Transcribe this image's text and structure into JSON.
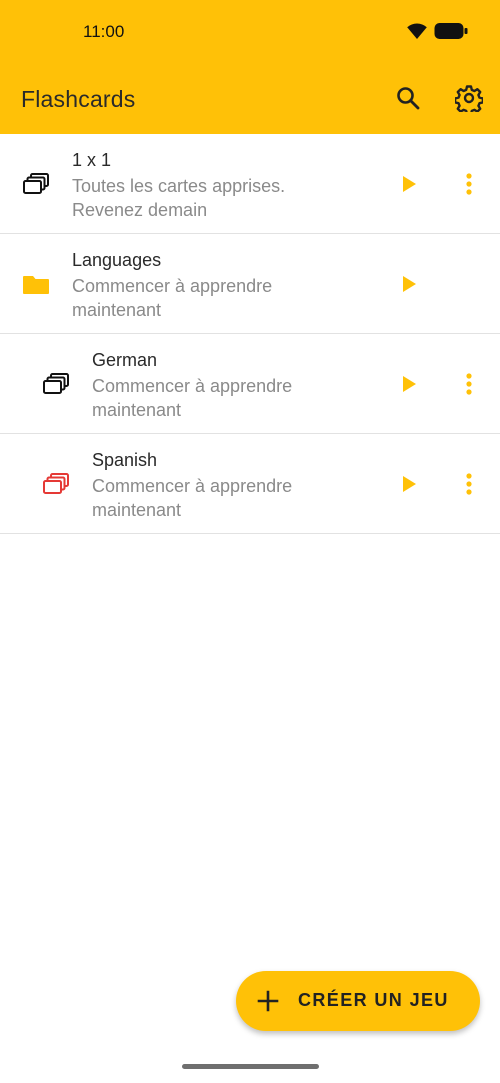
{
  "status_bar": {
    "time": "11:00",
    "wifi_icon": "wifi-icon",
    "battery_icon": "battery-icon"
  },
  "appbar": {
    "title": "Flashcards",
    "search_icon": "search-icon",
    "settings_icon": "gear-icon",
    "color": "#FFC107"
  },
  "decks": [
    {
      "name": "1 x 1",
      "line1": "Toutes les cartes apprises.",
      "line2": "Revenez demain",
      "icon": "cards-icon",
      "icon_color": "#111111",
      "has_menu": true
    },
    {
      "name": "Languages",
      "line1": "Commencer à apprendre",
      "line2": "maintenant",
      "icon": "folder-icon",
      "icon_color": "#FFC107",
      "has_menu": false
    },
    {
      "name": "German",
      "line1": "Commencer à apprendre",
      "line2": "maintenant",
      "icon": "cards-icon",
      "icon_color": "#111111",
      "has_menu": true
    },
    {
      "name": "Spanish",
      "line1": "Commencer à apprendre",
      "line2": "maintenant",
      "icon": "cards-icon",
      "icon_color": "#E53935",
      "has_menu": true
    }
  ],
  "fab": {
    "label": "CRÉER UN JEU",
    "icon": "plus-icon"
  }
}
